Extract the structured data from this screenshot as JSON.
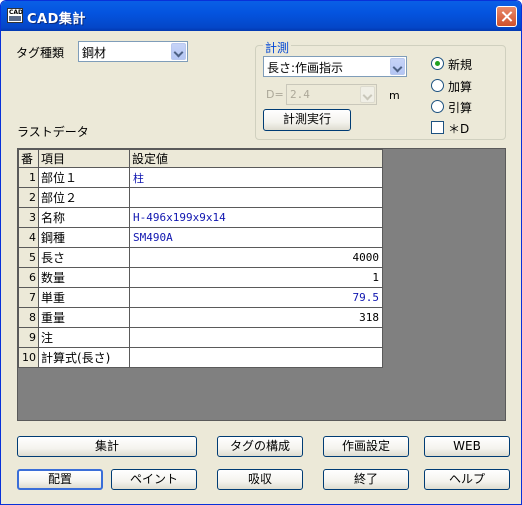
{
  "window": {
    "title": "CAD集計"
  },
  "tag": {
    "label": "タグ種類",
    "value": "鋼材"
  },
  "measure": {
    "group_title": "計測",
    "mode_value": "長さ:作画指示",
    "d_label": "D=",
    "d_value": "2.4",
    "unit": "m",
    "exec_button": "計測実行",
    "radios": [
      {
        "label": "新規",
        "selected": true
      },
      {
        "label": "加算",
        "selected": false
      },
      {
        "label": "引算",
        "selected": false
      }
    ],
    "checkbox_label": "＊D",
    "checkbox_checked": false
  },
  "last_data": {
    "label": "ラストデータ"
  },
  "table": {
    "columns": [
      "番",
      "項目",
      "設定値"
    ],
    "rows": [
      {
        "no": "1",
        "item": "部位１",
        "value": "柱",
        "align": "left",
        "color": "blue"
      },
      {
        "no": "2",
        "item": "部位２",
        "value": "",
        "align": "left",
        "color": "blue"
      },
      {
        "no": "3",
        "item": "名称",
        "value": "H-496x199x9x14",
        "align": "left",
        "color": "blue"
      },
      {
        "no": "4",
        "item": "鋼種",
        "value": "SM490A",
        "align": "left",
        "color": "blue"
      },
      {
        "no": "5",
        "item": "長さ",
        "value": "4000",
        "align": "right",
        "color": "black"
      },
      {
        "no": "6",
        "item": "数量",
        "value": "1",
        "align": "right",
        "color": "black"
      },
      {
        "no": "7",
        "item": "単重",
        "value": "79.5",
        "align": "right",
        "color": "blue"
      },
      {
        "no": "8",
        "item": "重量",
        "value": "318",
        "align": "right",
        "color": "black"
      },
      {
        "no": "9",
        "item": "注",
        "value": "",
        "align": "left",
        "color": "black"
      },
      {
        "no": "10",
        "item": "計算式(長さ)",
        "value": "",
        "align": "left",
        "color": "black"
      }
    ]
  },
  "buttons": {
    "shukei": "集計",
    "tag_config": "タグの構成",
    "draw_settings": "作画設定",
    "web": "WEB",
    "haichi": "配置",
    "paint": "ペイント",
    "absorb": "吸収",
    "exit": "終了",
    "help": "ヘルプ"
  },
  "colors": {
    "titlebar": "#0454df",
    "window_bg": "#ece9d8",
    "value_blue": "#1016b0",
    "group_title": "#0046d5"
  }
}
